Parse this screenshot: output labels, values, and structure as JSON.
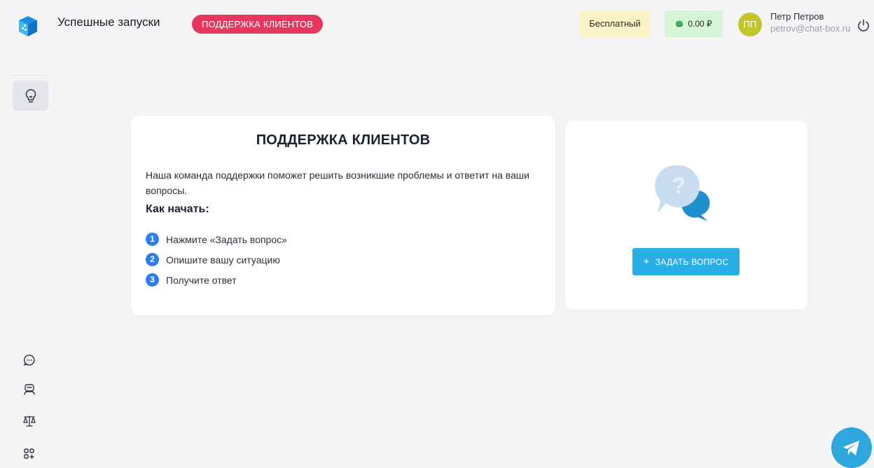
{
  "header": {
    "app_title": "Успешные запуски",
    "section_pill": "ПОДДЕРЖКА КЛИЕНТОВ",
    "plan": "Бесплатный",
    "balance": "0.00 ₽",
    "user": {
      "initials": "ПП",
      "name": "Петр Петров",
      "email": "petrov@chat-box.ru"
    }
  },
  "sidebar": {
    "top_items": [
      {
        "icon": "lightbulb-icon",
        "active": true
      }
    ],
    "bottom_items": [
      {
        "icon": "chat-bubble-icon"
      },
      {
        "icon": "robot-icon"
      },
      {
        "icon": "scales-icon"
      },
      {
        "icon": "apps-add-icon"
      }
    ]
  },
  "support": {
    "title": "ПОДДЕРЖКА КЛИЕНТОВ",
    "description": "Наша команда поддержки поможет решить возникшие проблемы и ответит на ваши вопросы.",
    "subtitle": "Как начать:",
    "steps": [
      {
        "num": "1",
        "text": "Нажмите «Задать вопрос»"
      },
      {
        "num": "2",
        "text": "Опишите вашу ситуацию"
      },
      {
        "num": "3",
        "text": "Получите ответ"
      }
    ],
    "ask_button": "ЗАДАТЬ ВОПРОС"
  },
  "colors": {
    "accent_pink": "#e8375d",
    "primary_blue": "#29aee6",
    "step_blue": "#2e7cf0",
    "plan_bg": "#fbf3c8",
    "balance_bg": "#d5f5d6",
    "avatar_bg": "#c2c62b",
    "telegram": "#2ea6de"
  }
}
